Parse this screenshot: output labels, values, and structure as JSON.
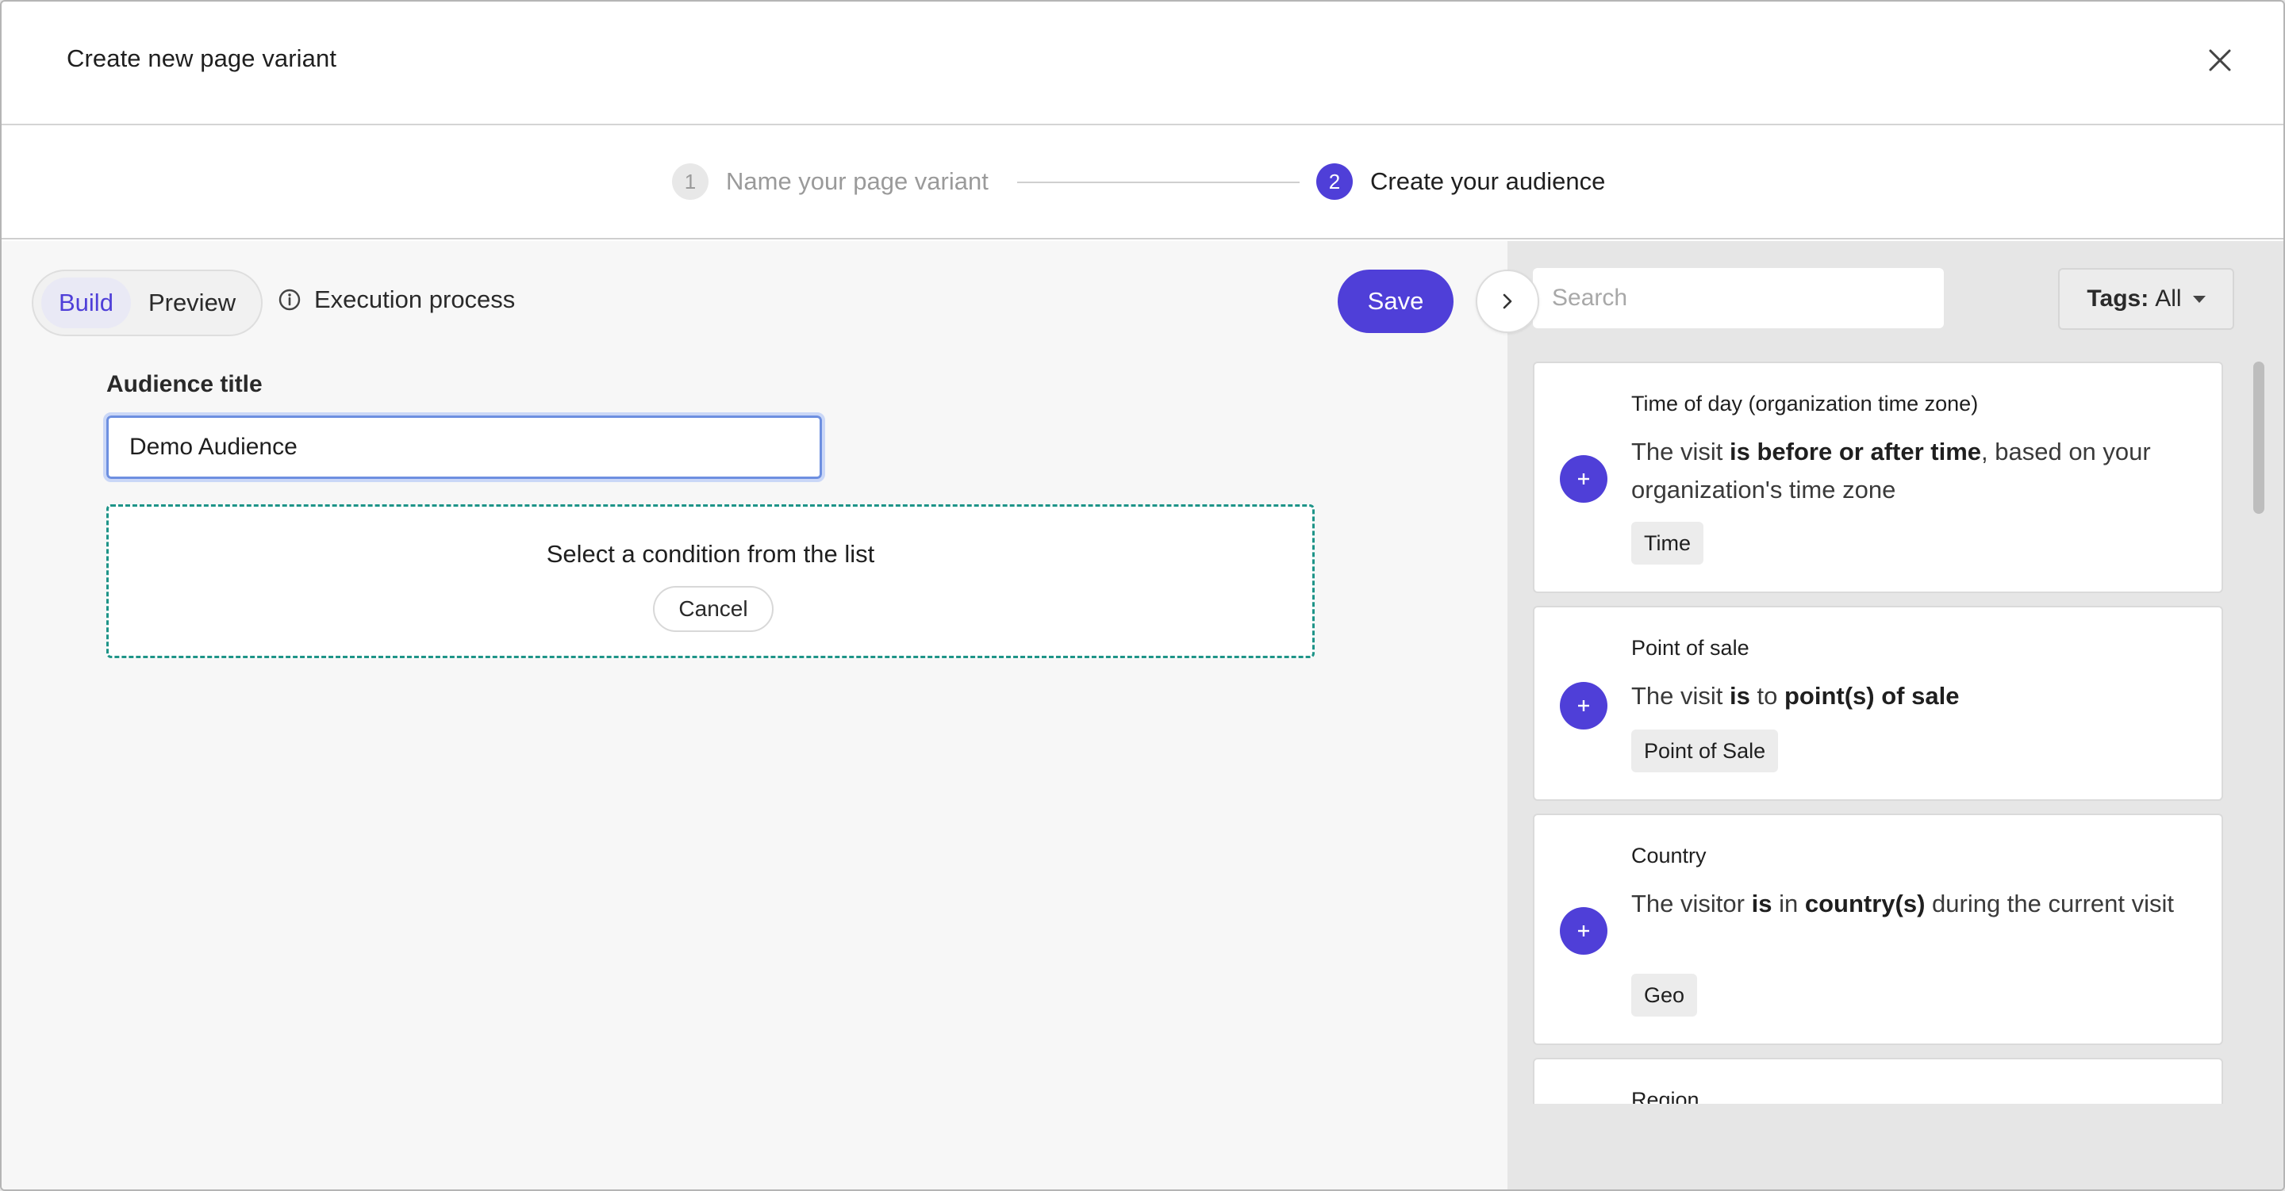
{
  "modal": {
    "title": "Create new page variant"
  },
  "stepper": {
    "steps": [
      {
        "number": "1",
        "label": "Name your page variant"
      },
      {
        "number": "2",
        "label": "Create your audience"
      }
    ]
  },
  "toolbar": {
    "build_label": "Build",
    "preview_label": "Preview",
    "execution_label": "Execution process",
    "save_label": "Save"
  },
  "audience": {
    "title_label": "Audience title",
    "title_value": "Demo Audience"
  },
  "dropzone": {
    "message": "Select a condition from the list",
    "cancel_label": "Cancel"
  },
  "conditions_panel": {
    "search_placeholder": "Search",
    "tags_label": "Tags:",
    "tags_value": "All",
    "items": [
      {
        "title": "Time of day (organization time zone)",
        "desc_parts": [
          "The visit ",
          "is before or after time",
          ", based on your organization's time zone"
        ],
        "tag": "Time"
      },
      {
        "title": "Point of sale",
        "desc_parts": [
          "The visit ",
          "is",
          " to ",
          "point(s) of sale"
        ],
        "tag": "Point of Sale"
      },
      {
        "title": "Country",
        "desc_parts": [
          "The visitor ",
          "is",
          " in ",
          "country(s)",
          " during the current visit"
        ],
        "tag": "Geo"
      },
      {
        "title": "Region"
      }
    ]
  },
  "colors": {
    "accent": "#4f3fd8",
    "dropzone_border": "#1e9488",
    "panel_bg": "#e6e6e6"
  }
}
